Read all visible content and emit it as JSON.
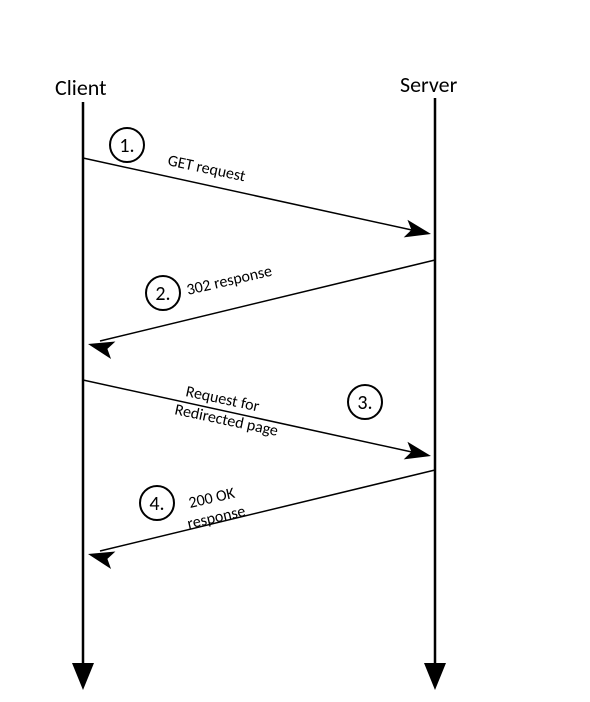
{
  "actors": {
    "client": "Client",
    "server": "Server"
  },
  "messages": {
    "m1": {
      "num": "1.",
      "label": "GET request"
    },
    "m2": {
      "num": "2.",
      "label": "302 response"
    },
    "m3": {
      "num": "3.",
      "label_line1": "Request for",
      "label_line2": "Redirected page"
    },
    "m4": {
      "num": "4.",
      "label_line1": "200 OK",
      "label_line2": "response"
    }
  }
}
